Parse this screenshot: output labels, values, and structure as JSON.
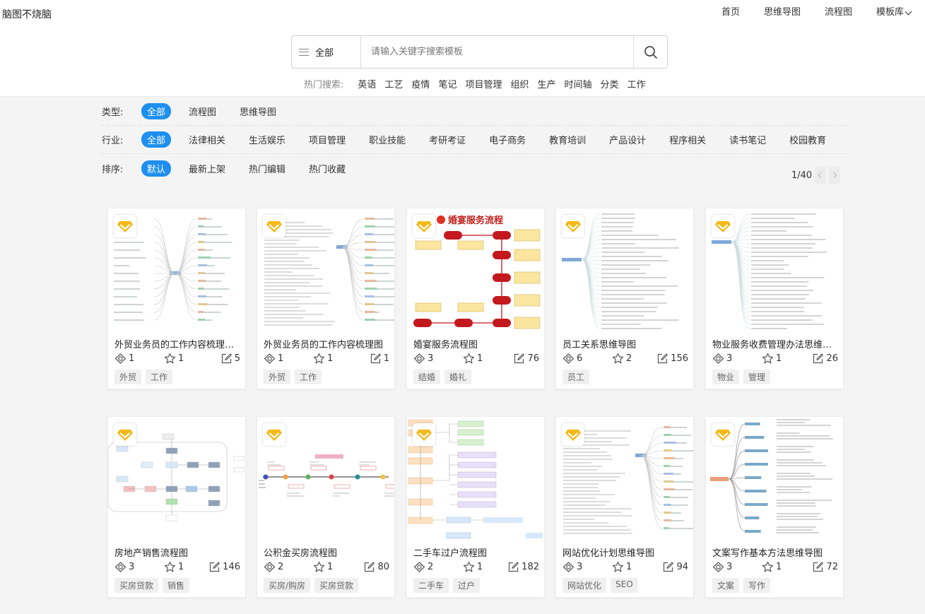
{
  "app": {
    "logo": "脑图不烧脑"
  },
  "nav": [
    {
      "label": "首页"
    },
    {
      "label": "思维导图"
    },
    {
      "label": "流程图"
    },
    {
      "label": "模板库",
      "has_dropdown": true
    }
  ],
  "search": {
    "category": "全部",
    "placeholder": "请输入关键字搜索模板",
    "value": ""
  },
  "hot_search": {
    "label": "热门搜索:",
    "items": [
      "英语",
      "工艺",
      "疫情",
      "笔记",
      "项目管理",
      "组织",
      "生产",
      "时间轴",
      "分类",
      "工作"
    ]
  },
  "filters": {
    "type": {
      "label": "类型:",
      "options": [
        "全部",
        "流程图",
        "思维导图"
      ],
      "active": "全部"
    },
    "industry": {
      "label": "行业:",
      "options": [
        "全部",
        "法律相关",
        "生活娱乐",
        "项目管理",
        "职业技能",
        "考研考证",
        "电子商务",
        "教育培训",
        "产品设计",
        "程序相关",
        "读书笔记",
        "校园教育"
      ],
      "active": "全部"
    },
    "sort": {
      "label": "排序:",
      "options": [
        "默认",
        "最新上架",
        "热门编辑",
        "热门收藏"
      ],
      "active": "默认"
    }
  },
  "pagination": {
    "text": "1/40"
  },
  "colors": {
    "accent": "#1e8ff0",
    "vip_badge": "#f5b400"
  },
  "cards": [
    {
      "title": "外贸业务员的工作内容梳理图...",
      "views": "1",
      "stars": "1",
      "edits": "5",
      "tags": [
        "外贸",
        "工作"
      ],
      "thumb": "mindmap-center"
    },
    {
      "title": "外贸业务员的工作内容梳理图",
      "views": "1",
      "stars": "1",
      "edits": "1",
      "tags": [
        "外贸",
        "工作"
      ],
      "thumb": "mindmap-dense"
    },
    {
      "title": "婚宴服务流程图",
      "views": "3",
      "stars": "1",
      "edits": "76",
      "tags": [
        "结婚",
        "婚礼"
      ],
      "thumb": "wedding-flow",
      "thumb_heading": "婚宴服务流程"
    },
    {
      "title": "员工关系思维导图",
      "views": "6",
      "stars": "2",
      "edits": "156",
      "tags": [
        "员工"
      ],
      "thumb": "mindmap-left"
    },
    {
      "title": "物业服务收费管理办法思维导图",
      "views": "3",
      "stars": "1",
      "edits": "26",
      "tags": [
        "物业",
        "管理"
      ],
      "thumb": "mindmap-list"
    },
    {
      "title": "房地产销售流程图",
      "views": "3",
      "stars": "1",
      "edits": "146",
      "tags": [
        "买房贷款",
        "销售"
      ],
      "thumb": "flowchart-boxes"
    },
    {
      "title": "公积金买房流程图",
      "views": "2",
      "stars": "1",
      "edits": "80",
      "tags": [
        "买房/购房",
        "买房贷款"
      ],
      "thumb": "timeline"
    },
    {
      "title": "二手车过户流程图",
      "views": "2",
      "stars": "1",
      "edits": "182",
      "tags": [
        "二手车",
        "过户"
      ],
      "thumb": "tree-flow"
    },
    {
      "title": "网站优化计划思维导图",
      "views": "3",
      "stars": "1",
      "edits": "94",
      "tags": [
        "网站优化",
        "SEO"
      ],
      "thumb": "mindmap-dense"
    },
    {
      "title": "文案写作基本方法思维导图",
      "views": "3",
      "stars": "1",
      "edits": "72",
      "tags": [
        "文案",
        "写作"
      ],
      "thumb": "mindmap-red"
    }
  ]
}
